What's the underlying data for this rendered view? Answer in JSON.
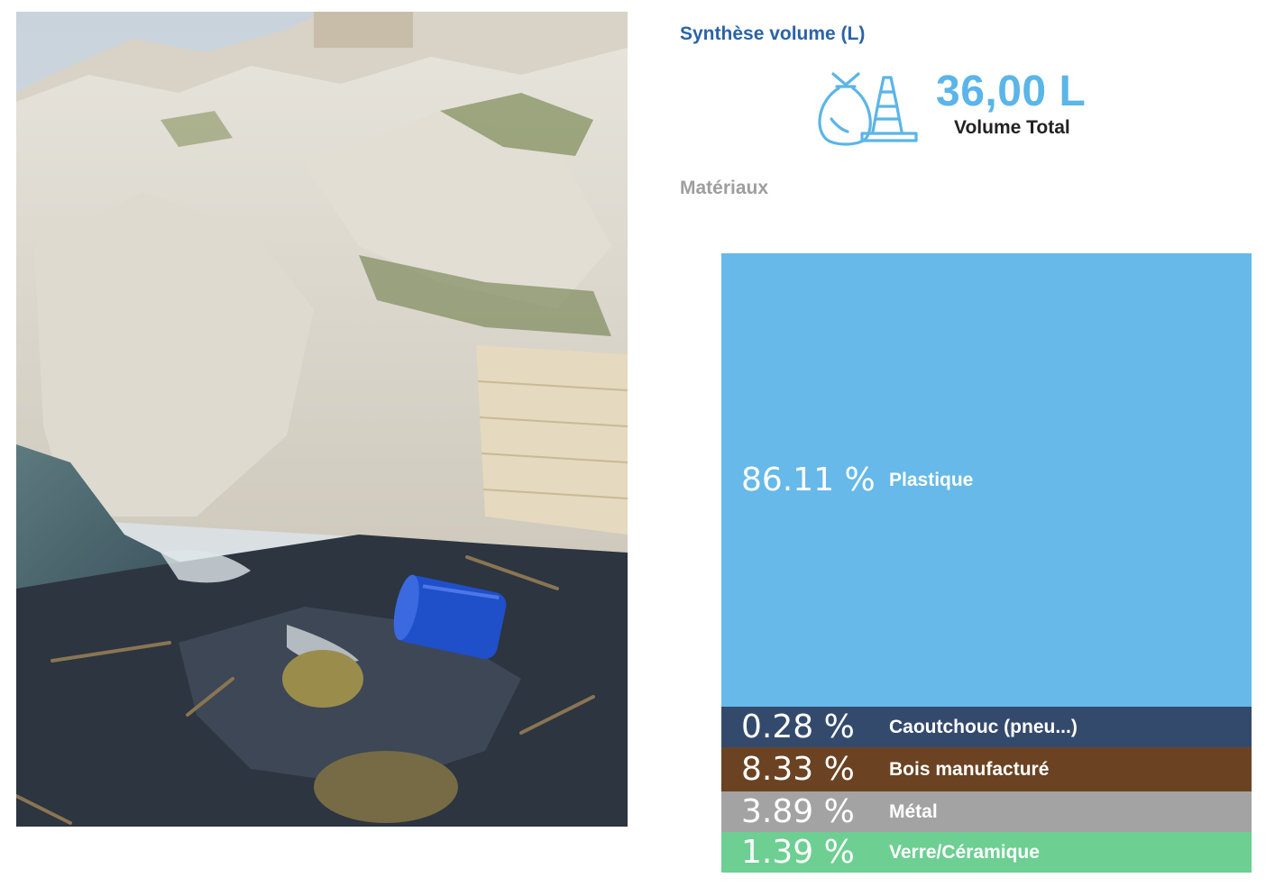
{
  "summary": {
    "title": "Synthèse volume (L)",
    "total_value": "36,00 L",
    "total_label": "Volume Total",
    "icon": "trash-bag-and-cone-icon"
  },
  "materials": {
    "heading": "Matériaux",
    "items": [
      {
        "pct": "86.11 %",
        "label": "Plastique",
        "color": "#66b9e9",
        "share": 86.11
      },
      {
        "pct": "0.28 %",
        "label": "Caoutchouc (pneu...)",
        "color": "#344a6d",
        "share": 0.28
      },
      {
        "pct": "8.33 %",
        "label": "Bois manufacturé",
        "color": "#6b4322",
        "share": 8.33
      },
      {
        "pct": "3.89 %",
        "label": "Métal",
        "color": "#a3a3a3",
        "share": 3.89
      },
      {
        "pct": "1.39 %",
        "label": "Verre/Céramique",
        "color": "#6dcf92",
        "share": 1.39
      }
    ]
  },
  "colors": {
    "title_blue": "#2b63a8",
    "value_blue": "#5bb5e8"
  }
}
